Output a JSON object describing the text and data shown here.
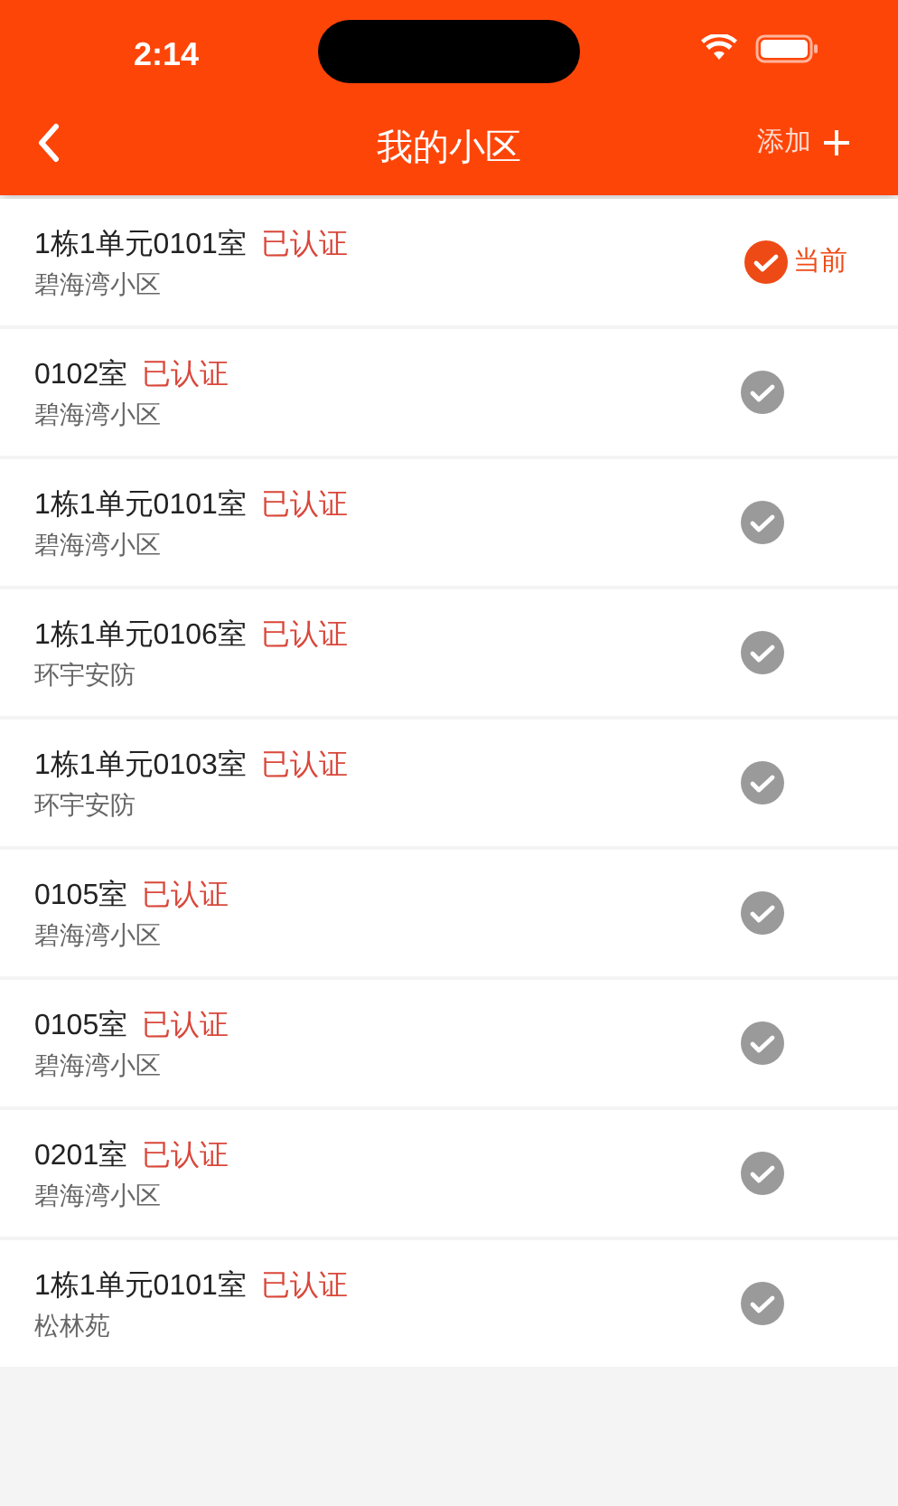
{
  "status_bar": {
    "time": "2:14"
  },
  "nav": {
    "title": "我的小区",
    "action": "添加"
  },
  "current_label": "当前",
  "houses": [
    {
      "room": "1栋1单元0101室",
      "status": "已认证",
      "community": "碧海湾小区",
      "selected": true
    },
    {
      "room": "0102室",
      "status": "已认证",
      "community": "碧海湾小区",
      "selected": false
    },
    {
      "room": "1栋1单元0101室",
      "status": "已认证",
      "community": "碧海湾小区",
      "selected": false
    },
    {
      "room": "1栋1单元0106室",
      "status": "已认证",
      "community": "环宇安防",
      "selected": false
    },
    {
      "room": "1栋1单元0103室",
      "status": "已认证",
      "community": "环宇安防",
      "selected": false
    },
    {
      "room": "0105室",
      "status": "已认证",
      "community": "碧海湾小区",
      "selected": false
    },
    {
      "room": "0105室",
      "status": "已认证",
      "community": "碧海湾小区",
      "selected": false
    },
    {
      "room": "0201室",
      "status": "已认证",
      "community": "碧海湾小区",
      "selected": false
    },
    {
      "room": "1栋1单元0101室",
      "status": "已认证",
      "community": "松林苑",
      "selected": false
    }
  ]
}
